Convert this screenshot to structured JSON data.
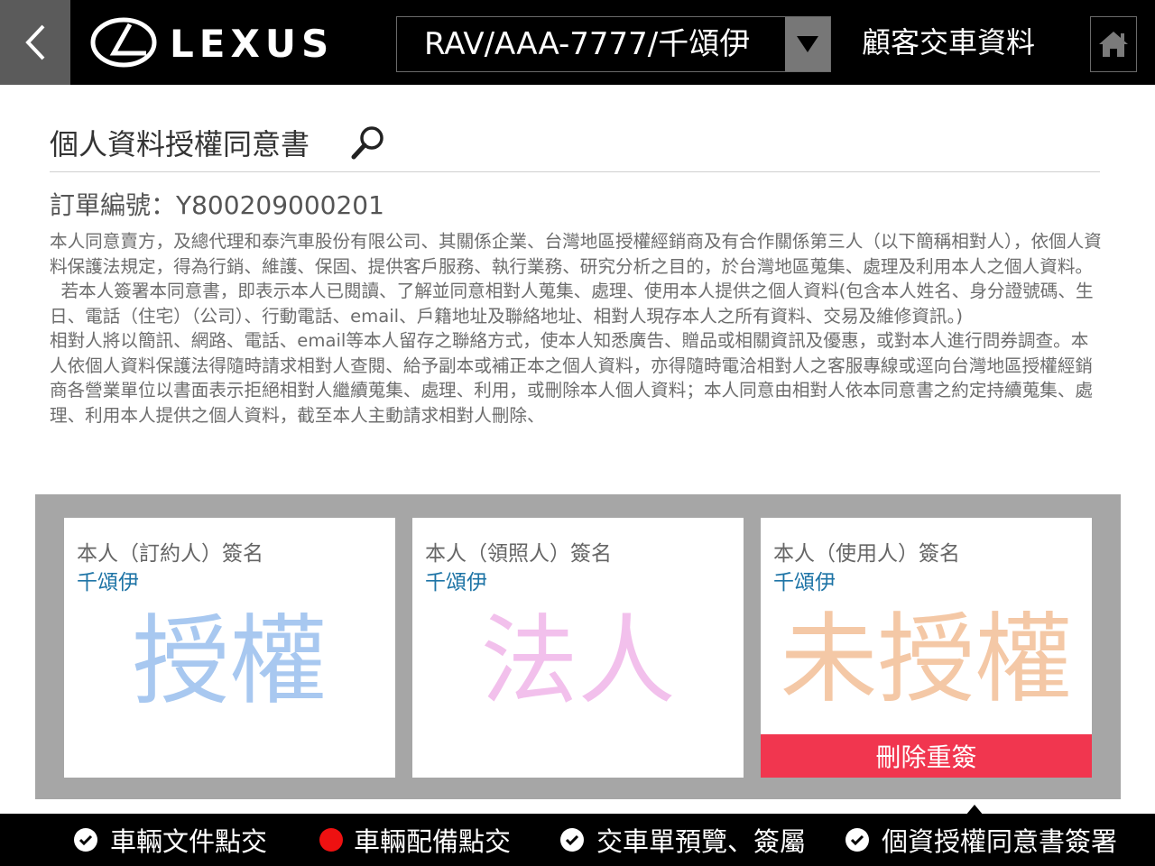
{
  "header": {
    "brand": "LEXUS",
    "vehicle_select_value": "RAV/AAA-7777/千頌伊",
    "title": "顧客交車資料"
  },
  "page": {
    "ghost_title": "個人資料授權同意書",
    "title": "個人資料授權同意書",
    "order_label": "訂單編號：",
    "order_number": "Y800209000201",
    "consent_paragraphs": [
      "本人同意賣方，及總代理和泰汽車股份有限公司、其關係企業、台灣地區授權經銷商及有合作關係第三人（以下簡稱相對人），依個人資料保護法規定，得為行銷、維護、保固、提供客戶服務、執行業務、研究分析之目的，於台灣地區蒐集、處理及利用本人之個人資料。",
      "若本人簽署本同意書，即表示本人已閱讀、了解並同意相對人蒐集、處理、使用本人提供之個人資料(包含本人姓名、身分證號碼、生日、電話（住宅）（公司）、行動電話、email、戶籍地址及聯絡地址、相對人現存本人之所有資料、交易及維修資訊。)",
      "相對人將以簡訊、網路、電話、email等本人留存之聯絡方式，使本人知悉廣告、贈品或相關資訊及優惠，或對本人進行問券調查。本人依個人資料保護法得隨時請求相對人查閱、給予副本或補正本之個人資料，亦得隨時電洽相對人之客服專線或逕向台灣地區授權經銷商各營業單位以書面表示拒絕相對人繼續蒐集、處理、利用，或刪除本人個人資料；本人同意由相對人依本同意書之約定持續蒐集、處理、利用本人提供之個人資料，截至本人主動請求相對人刪除、"
    ]
  },
  "signatures": [
    {
      "label": "本人（訂約人）簽名",
      "name": "千頌伊",
      "stamp": "授權",
      "stamp_color": "#a8c8f0"
    },
    {
      "label": "本人（領照人）簽名",
      "name": "千頌伊",
      "stamp": "法人",
      "stamp_color": "#f2c0ec"
    },
    {
      "label": "本人（使用人）簽名",
      "name": "千頌伊",
      "stamp": "未授權",
      "stamp_color": "#f4c8a6",
      "delete_label": "刪除重簽"
    }
  ],
  "bottom_nav": [
    {
      "label": "車輛文件點交",
      "status": "done"
    },
    {
      "label": "車輛配備點交",
      "status": "pending"
    },
    {
      "label": "交車單預覽、簽屬",
      "status": "done"
    },
    {
      "label": "個資授權同意書簽署",
      "status": "done",
      "active": true
    }
  ]
}
